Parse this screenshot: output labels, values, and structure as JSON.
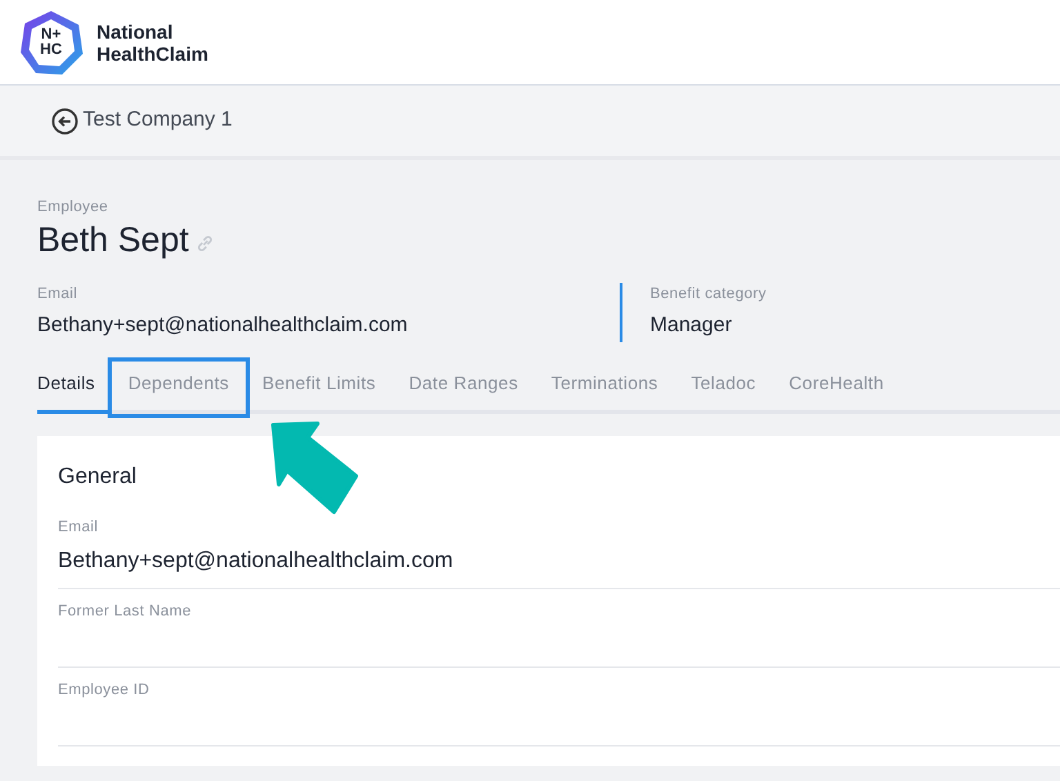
{
  "logo": {
    "mark": [
      "N+",
      "HC"
    ],
    "name": [
      "National",
      "HealthClaim"
    ]
  },
  "breadcrumb": {
    "label": "Test Company 1"
  },
  "employee": {
    "label": "Employee",
    "name": "Beth Sept"
  },
  "summary": [
    {
      "label": "Email",
      "value": "Bethany+sept@nationalhealthclaim.com"
    },
    {
      "label": "Benefit category",
      "value": "Manager"
    }
  ],
  "tabs": [
    {
      "label": "Details",
      "selected": true,
      "highlighted": false
    },
    {
      "label": "Dependents",
      "selected": false,
      "highlighted": true
    },
    {
      "label": "Benefit Limits",
      "selected": false,
      "highlighted": false
    },
    {
      "label": "Date Ranges",
      "selected": false,
      "highlighted": false
    },
    {
      "label": "Terminations",
      "selected": false,
      "highlighted": false
    },
    {
      "label": "Teladoc",
      "selected": false,
      "highlighted": false
    },
    {
      "label": "CoreHealth",
      "selected": false,
      "highlighted": false
    }
  ],
  "section": {
    "title": "General",
    "fields": [
      {
        "label": "Email",
        "value": "Bethany+sept@nationalhealthclaim.com"
      },
      {
        "label": "Former Last Name"
      },
      {
        "label": "Employee ID"
      }
    ]
  }
}
